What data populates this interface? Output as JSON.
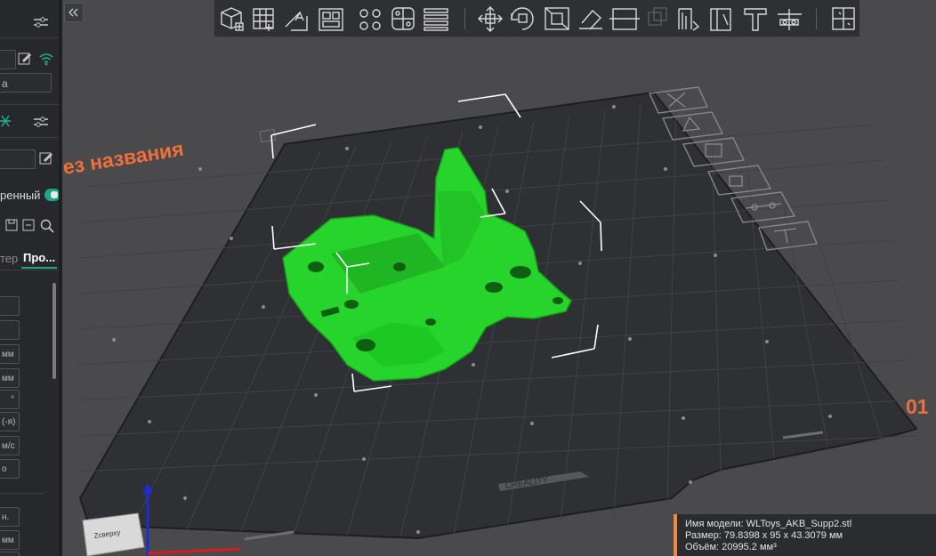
{
  "left_panel": {
    "field_a_text": "а",
    "toggle_label": "ренный",
    "tab_inactive": "тер",
    "tab_active": "Про...",
    "row_values": [
      "",
      "",
      "мм",
      "мм",
      "°",
      "(-я)",
      "м/с",
      "о",
      "",
      "н.",
      "мм",
      "мм"
    ]
  },
  "viewport": {
    "plate_name": "ез названия",
    "plate_number": "01",
    "bed_brand": "CREALITY",
    "axis_label": "Zсверху"
  },
  "info": {
    "model_name": "Имя модели: WLToys_AKB_Supp2.stl",
    "size": "Размер: 79.8398 x 95 x 43.3079 мм",
    "volume": "Объём: 20995.2 мм³"
  },
  "colors": {
    "accent_orange": "#f08a40",
    "model_green": "#27d42b",
    "toggle_teal": "#1fa58a",
    "active_tab_underline": "#1fa58a"
  },
  "toolbar_icons": [
    "add-object-icon",
    "grid-arrange-icon",
    "orient-icon",
    "layout-icon",
    "split-objects-icon",
    "split-parts-icon",
    "layers-icon",
    "move-icon",
    "rotate-icon",
    "scale-icon",
    "lay-on-face-icon",
    "cut-icon",
    "support-paint-icon",
    "seam-paint-icon",
    "support-icon",
    "text-icon",
    "measure-icon",
    "assembly-icon"
  ],
  "plate_side_icons": [
    "close-plate-icon",
    "orient-plate-icon",
    "arrange-plate-icon",
    "lock-plate-icon",
    "settings-plate-icon",
    "move-plate-icon"
  ]
}
